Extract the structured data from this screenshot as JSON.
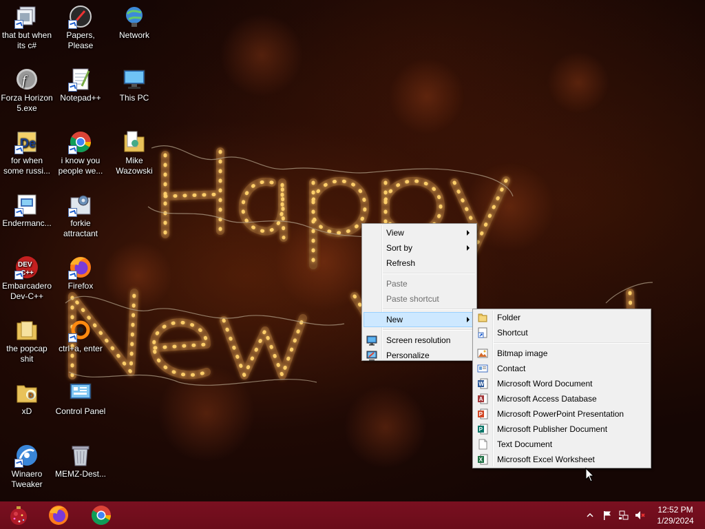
{
  "desktop": {
    "icons": [
      {
        "label": "that but when its c#",
        "icon": "shortcut-stack-icon"
      },
      {
        "label": "Papers, Please",
        "icon": "papers-please-icon"
      },
      {
        "label": "Network",
        "icon": "network-icon"
      },
      {
        "label": "Forza Horizon 5.exe",
        "icon": "flash-icon"
      },
      {
        "label": "Notepad++",
        "icon": "notepad-plus-plus-icon"
      },
      {
        "label": "This PC",
        "icon": "this-pc-icon"
      },
      {
        "label": "for when some russi...",
        "icon": "devc-doc-icon"
      },
      {
        "label": "i know you people we...",
        "icon": "chrome-icon"
      },
      {
        "label": "Mike Wazowski",
        "icon": "user-folder-icon"
      },
      {
        "label": "Endermanc...",
        "icon": "shortcut-icon"
      },
      {
        "label": "forkie attractant",
        "icon": "gear-program-icon"
      },
      {
        "label": "Embarcadero Dev-C++",
        "icon": "dev-cpp-icon"
      },
      {
        "label": "Firefox",
        "icon": "firefox-icon"
      },
      {
        "label": "the popcap shit",
        "icon": "folder-icon"
      },
      {
        "label": "ctrl+a, enter",
        "icon": "orange-ring-icon"
      },
      {
        "label": "xD",
        "icon": "xd-folder-icon"
      },
      {
        "label": "Control Panel",
        "icon": "control-panel-icon"
      },
      {
        "label": "Winaero Tweaker",
        "icon": "winaero-icon"
      },
      {
        "label": "MEMZ-Dest...",
        "icon": "recycle-bin-icon"
      }
    ]
  },
  "context_menu": {
    "items": [
      {
        "label": "View",
        "submenu": true,
        "enabled": true
      },
      {
        "label": "Sort by",
        "submenu": true,
        "enabled": true
      },
      {
        "label": "Refresh",
        "submenu": false,
        "enabled": true
      },
      {
        "label": "Paste",
        "submenu": false,
        "enabled": false
      },
      {
        "label": "Paste shortcut",
        "submenu": false,
        "enabled": false
      },
      {
        "label": "New",
        "submenu": true,
        "enabled": true,
        "highlighted": true
      },
      {
        "label": "Screen resolution",
        "submenu": false,
        "enabled": true,
        "icon": "screen-resolution-icon"
      },
      {
        "label": "Personalize",
        "submenu": false,
        "enabled": true,
        "icon": "personalize-icon"
      }
    ]
  },
  "new_submenu": {
    "items": [
      {
        "label": "Folder",
        "icon": "folder-icon"
      },
      {
        "label": "Shortcut",
        "icon": "shortcut-icon"
      },
      {
        "label": "Bitmap image",
        "icon": "bitmap-icon"
      },
      {
        "label": "Contact",
        "icon": "contact-icon"
      },
      {
        "label": "Microsoft Word Document",
        "icon": "word-icon"
      },
      {
        "label": "Microsoft Access Database",
        "icon": "access-icon"
      },
      {
        "label": "Microsoft PowerPoint Presentation",
        "icon": "powerpoint-icon"
      },
      {
        "label": "Microsoft Publisher Document",
        "icon": "publisher-icon"
      },
      {
        "label": "Text Document",
        "icon": "text-document-icon"
      },
      {
        "label": "Microsoft Excel Worksheet",
        "icon": "excel-icon"
      }
    ]
  },
  "taskbar": {
    "pinned": [
      {
        "name": "start-button",
        "icon": "christmas-ornament-icon"
      },
      {
        "name": "firefox-taskbar",
        "icon": "firefox-icon"
      },
      {
        "name": "chrome-taskbar",
        "icon": "chrome-icon"
      }
    ],
    "tray": {
      "clock_time": "12:52 PM",
      "clock_date": "1/29/2024",
      "icons": [
        "show-hidden-icons-chevron-icon",
        "action-center-flag-icon",
        "network-icon",
        "volume-muted-icon"
      ]
    }
  },
  "wallpaper": {
    "colors": {
      "background": "#150604",
      "lights": "#ffd36b"
    }
  },
  "colors": {
    "taskbar": "#6e0d1c",
    "menu_bg": "#f0f0f0",
    "menu_highlight": "#cde8ff"
  }
}
